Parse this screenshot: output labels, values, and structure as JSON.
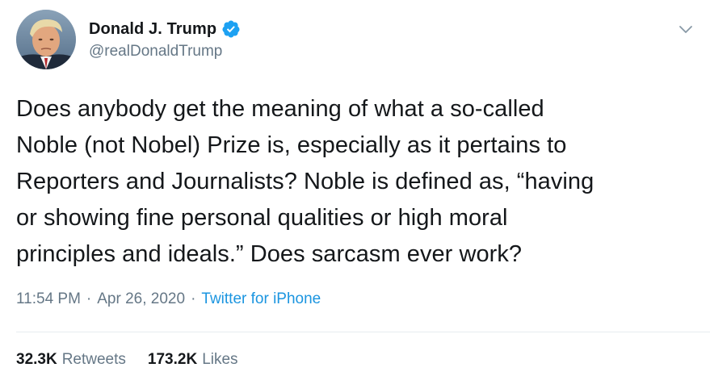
{
  "author": {
    "display_name": "Donald J. Trump",
    "handle": "@realDonaldTrump",
    "verified": true,
    "verified_color": "#1da1f2"
  },
  "tweet": {
    "text": "Does anybody get the meaning of what a so-called\nNoble (not Nobel) Prize is, especially as it pertains to\nReporters and Journalists? Noble is defined as, “having\nor showing fine personal qualities or high moral\nprinciples and ideals.” Does sarcasm ever work?",
    "time": "11:54 PM",
    "separator": "·",
    "date": "Apr 26, 2020",
    "source": "Twitter for iPhone"
  },
  "stats": {
    "retweets_count": "32.3K",
    "retweets_label": "Retweets",
    "likes_count": "173.2K",
    "likes_label": "Likes"
  },
  "icons": {
    "avatar": "avatar",
    "verified": "verified-badge-icon",
    "menu": "chevron-down-icon"
  },
  "colors": {
    "text": "#14171a",
    "secondary": "#657786",
    "link": "#1b95e0",
    "divider": "#e6ecf0"
  }
}
